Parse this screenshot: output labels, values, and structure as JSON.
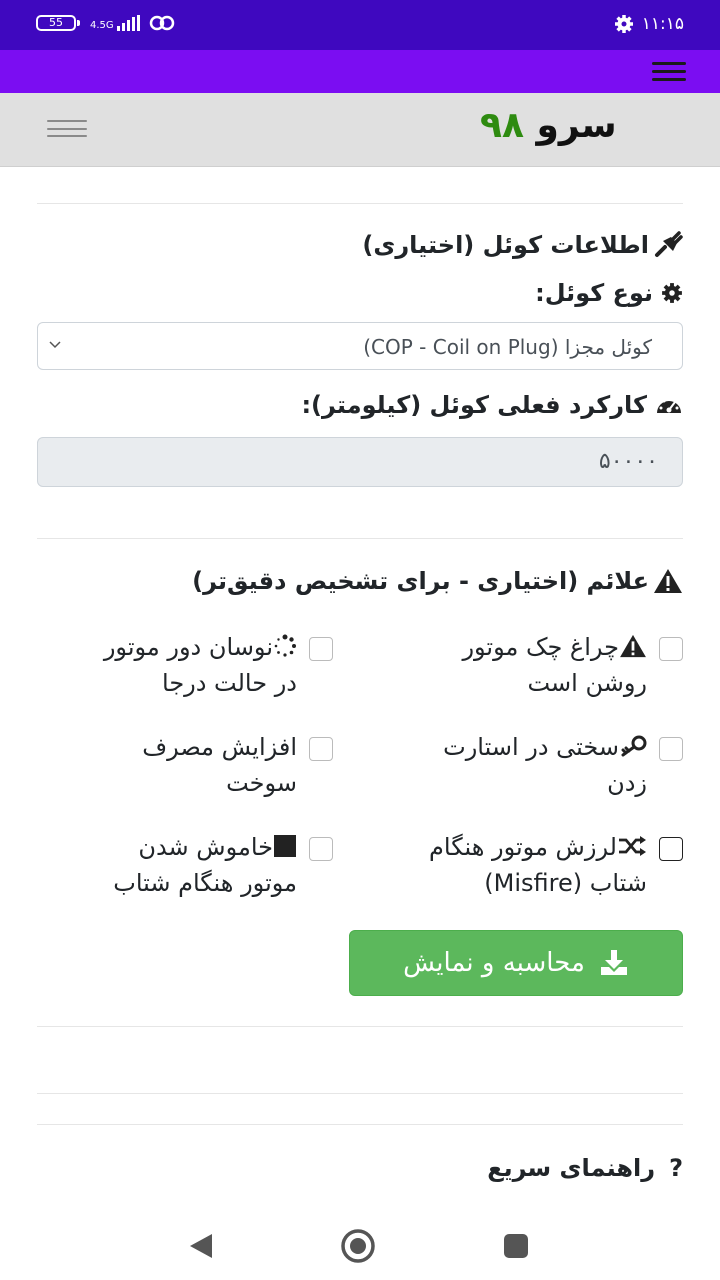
{
  "status_bar": {
    "battery": "55",
    "network": "4.5G",
    "time": "۱۱:۱۵"
  },
  "brand": {
    "name_text": "سرو",
    "name_number": "۹۸"
  },
  "coil_section": {
    "title": "اطلاعات کوئل (اختیاری)",
    "title_icon": "plug-icon",
    "type_label": "نوع کوئل:",
    "type_icon": "gear-icon",
    "type_selected": "کوئل مجزا (COP - Coil on Plug)",
    "mileage_label": "کارکرد فعلی کوئل (کیلومتر):",
    "mileage_icon": "gauge-icon",
    "mileage_value": "۵۰۰۰۰"
  },
  "symptoms_section": {
    "title": "علائم (اختیاری - برای تشخیص دقیق‌تر)",
    "title_icon": "warning-icon",
    "items": [
      {
        "line1": "چراغ چک موتور",
        "line2": "روشن است",
        "icon": "warning-icon"
      },
      {
        "line1": "نوسان دور موتور",
        "line2": "در حالت درجا",
        "icon": "spinner-icon"
      },
      {
        "line1": "سختی در استارت",
        "line2": "زدن",
        "icon": "key-icon"
      },
      {
        "line1": "افزایش مصرف",
        "line2": "سوخت",
        "icon": ""
      },
      {
        "line1": "لرزش موتور هنگام",
        "line2": "شتاب (Misfire)",
        "icon": "shuffle-icon"
      },
      {
        "line1": "خاموش شدن",
        "line2": "موتور هنگام شتاب",
        "icon": "stop-icon"
      }
    ]
  },
  "actions": {
    "calculate_label": "محاسبه و نمایش",
    "calculate_icon": "download-icon"
  },
  "guide": {
    "title": "راهنمای سریع",
    "icon": "question-icon"
  },
  "colors": {
    "status_bar": "#3f08bf",
    "top_nav": "#7b0df2",
    "success": "#5cb85c",
    "brand_green": "#2e8b10"
  }
}
